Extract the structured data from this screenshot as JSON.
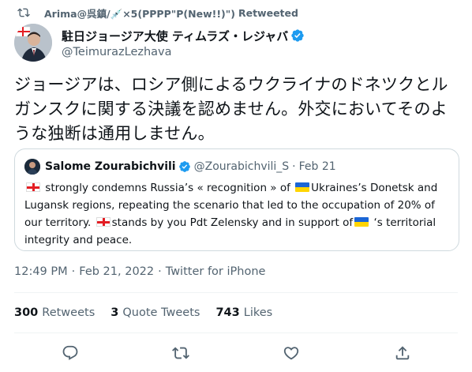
{
  "retweet_header": {
    "retweeter": "Arima@呉鎮/💉×5(PPPP\"P(New!!)\")",
    "suffix": "Retweeted"
  },
  "author": {
    "display_name": "駐日ジョージア大使 ティムラズ・レジャバ",
    "handle": "@TeimurazLezhava",
    "verified": true
  },
  "tweet": {
    "text": "ジョージアは、ロシア側によるウクライナのドネツクとルガンスクに関する決議を認めません。外交においてそのような独断は通用しません。"
  },
  "quoted_tweet": {
    "display_name": "Salome Zourabichvili",
    "handle": "@Zourabichvili_S",
    "separator": "·",
    "date": "Feb 21",
    "text_part1": " strongly condemns Russia’s « recognition » of ",
    "text_part2": "Ukraines’s Donetsk and Lugansk regions,  repeating the scenario that led to the occupation of 20% of our territory. ",
    "text_part3": "stands by you Pdt Zelensky and in support of",
    "text_part4": " ‘s territorial integrity and peace."
  },
  "meta": {
    "time": "12:49 PM",
    "dot1": "·",
    "date": "Feb 21, 2022",
    "dot2": "·",
    "source": "Twitter for iPhone"
  },
  "stats": {
    "retweets_count": "300",
    "retweets_label": "Retweets",
    "quotes_count": "3",
    "quotes_label": "Quote Tweets",
    "likes_count": "743",
    "likes_label": "Likes"
  },
  "icons": {
    "retweet": "retweet-icon",
    "verified": "verified-badge-icon",
    "reply": "reply-icon",
    "like": "heart-icon",
    "share": "share-icon"
  },
  "colors": {
    "text_primary": "#0f1419",
    "text_secondary": "#536471",
    "verified_blue": "#1d9bf0",
    "border": "#cfd9de"
  }
}
